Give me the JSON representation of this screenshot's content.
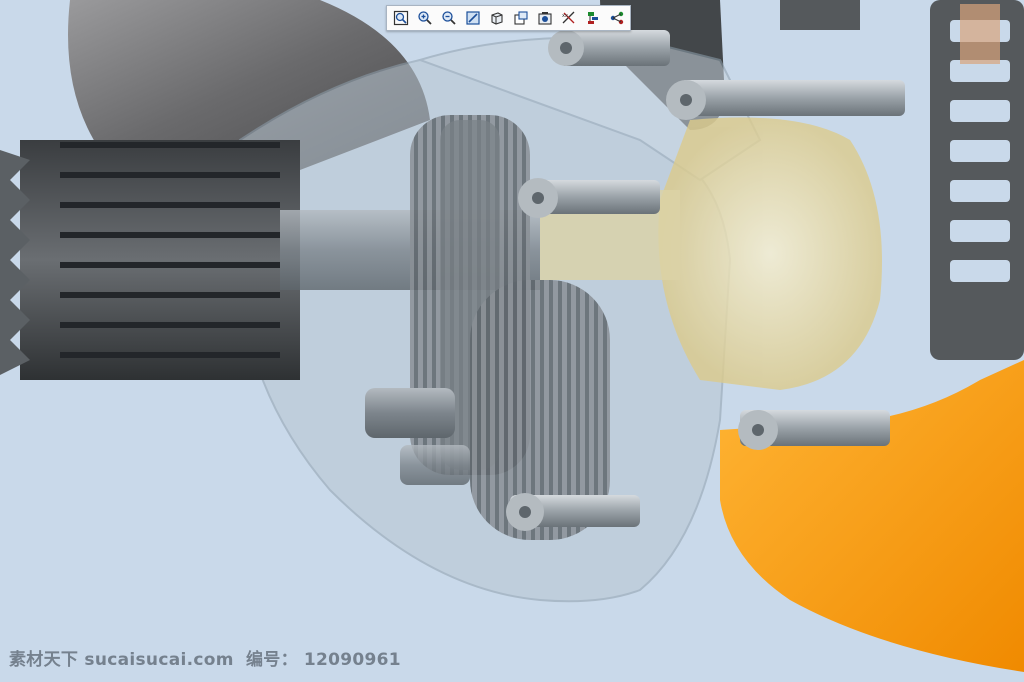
{
  "app": {
    "background": "#c9d9ea"
  },
  "toolbar": {
    "buttons": [
      {
        "id": "refit",
        "icon": "zoom-fit-icon"
      },
      {
        "id": "zoom-in",
        "icon": "zoom-in-icon"
      },
      {
        "id": "zoom-out",
        "icon": "zoom-out-icon"
      },
      {
        "id": "repaint",
        "icon": "repaint-icon"
      },
      {
        "id": "display-style",
        "icon": "display-style-icon"
      },
      {
        "id": "saved-views",
        "icon": "saved-views-icon"
      },
      {
        "id": "view-manager",
        "icon": "view-manager-icon"
      },
      {
        "id": "datum-display",
        "icon": "datum-display-icon"
      },
      {
        "id": "annotation-display",
        "icon": "annotation-display-icon"
      },
      {
        "id": "spin-center",
        "icon": "spin-center-icon"
      }
    ]
  },
  "model": {
    "colors": {
      "housing": "#7e8a96",
      "gear": "#8a9096",
      "shaft": "#8f969c",
      "bolt": "#9aa2a8",
      "cap": "#efe2b0",
      "handle": "#ff9e12",
      "knob": "#6f6f71",
      "bracket": "#4b4f52"
    }
  },
  "watermark": {
    "site": "素材天下 sucaisucai.com",
    "id_label": "编号：",
    "id_value": "12090961"
  }
}
